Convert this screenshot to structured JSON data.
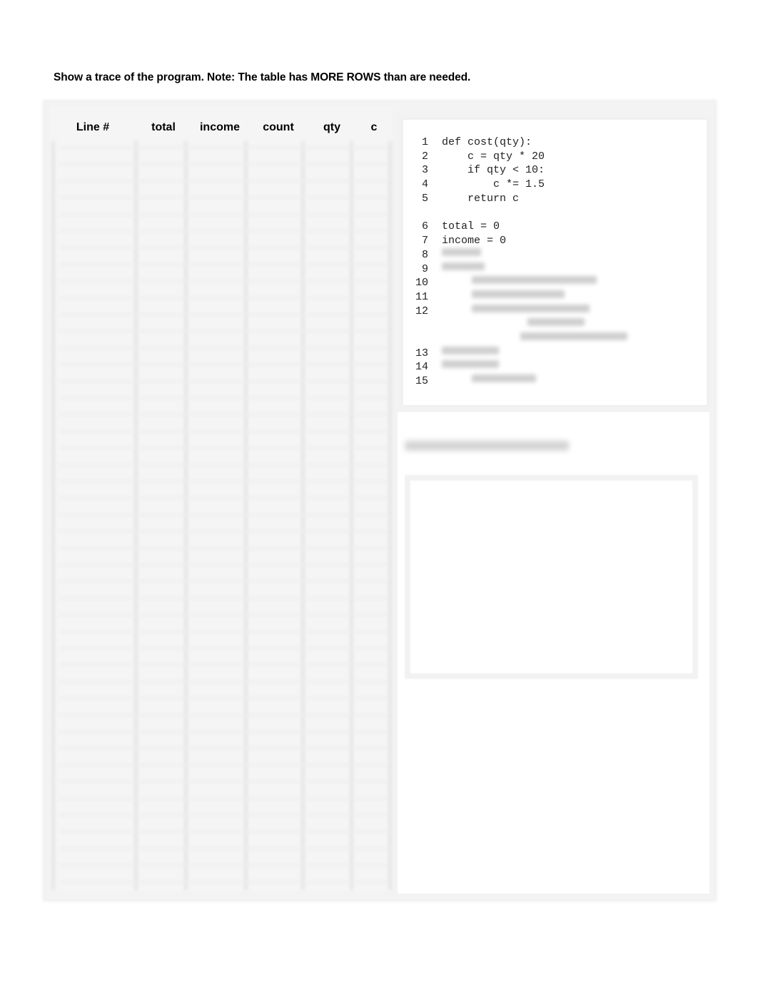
{
  "instruction": "Show a trace of the program.  Note: The table has MORE ROWS than are needed.",
  "trace_table": {
    "columns": [
      "Line #",
      "total",
      "income",
      "count",
      "qty",
      "c"
    ],
    "row_count": 45,
    "rows": []
  },
  "code": {
    "lines": [
      {
        "num": "1",
        "text": "def cost(qty):"
      },
      {
        "num": "2",
        "text": "    c = qty * 20"
      },
      {
        "num": "3",
        "text": "    if qty < 10:"
      },
      {
        "num": "4",
        "text": "        c *= 1.5"
      },
      {
        "num": "5",
        "text": "    return c"
      },
      {
        "num": "6",
        "text": "total = 0"
      },
      {
        "num": "7",
        "text": "income = 0"
      },
      {
        "num": "8",
        "text": ""
      },
      {
        "num": "9",
        "text": ""
      },
      {
        "num": "10",
        "text": ""
      },
      {
        "num": "11",
        "text": ""
      },
      {
        "num": "12",
        "text": ""
      },
      {
        "num": "13",
        "text": ""
      },
      {
        "num": "14",
        "text": ""
      },
      {
        "num": "15",
        "text": ""
      }
    ],
    "obscured_from_line": 8
  },
  "output": {
    "label": "",
    "value": ""
  }
}
